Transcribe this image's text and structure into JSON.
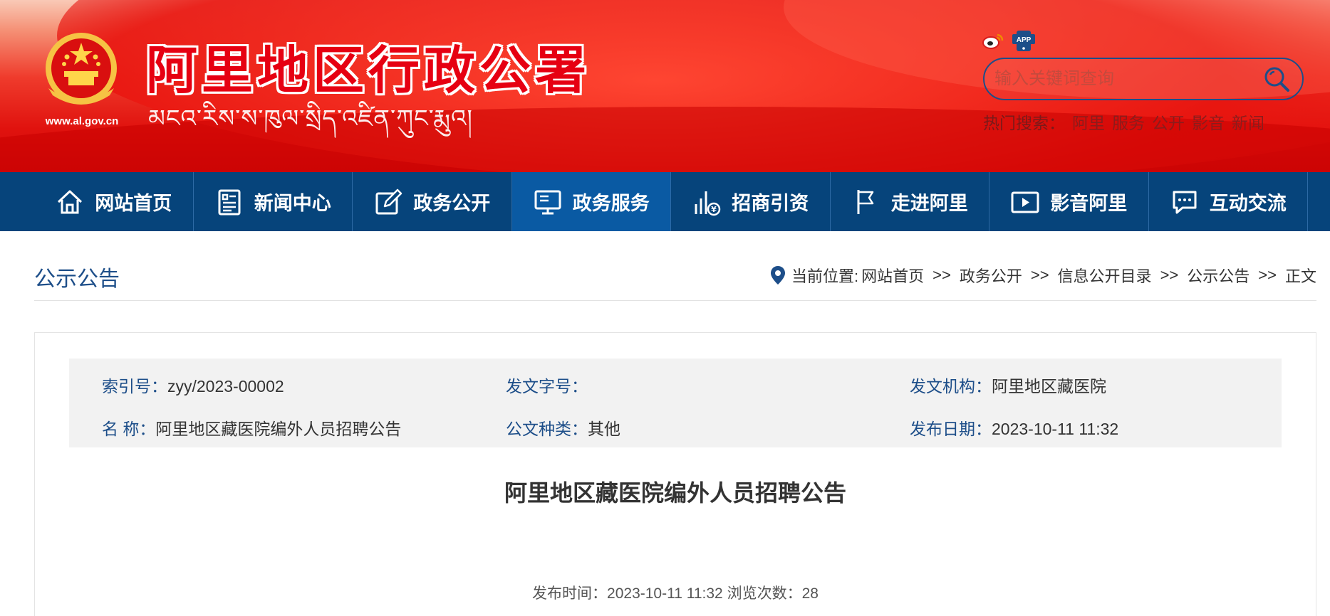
{
  "header": {
    "emblem_url": "www.al.gov.cn",
    "title": "阿里地区行政公署",
    "subtitle": "མངའ་རིས་ས་ཁུལ་སྲིད་འཛིན་ཀུང་རྨུའ།",
    "icons": [
      "weibo-icon",
      "app-icon"
    ],
    "app_label": "APP",
    "search": {
      "placeholder": "输入关键词查询"
    },
    "hot_search": {
      "label": "热门搜索：",
      "items": [
        "阿里",
        "服务",
        "公开",
        "影音",
        "新闻"
      ]
    },
    "colors": {
      "banner_red": "#e60012",
      "nav_blue": "#06447b",
      "accent_blue": "#1d4e89"
    }
  },
  "nav": {
    "items": [
      {
        "label": "网站首页",
        "icon": "home-icon"
      },
      {
        "label": "新闻中心",
        "icon": "news-icon"
      },
      {
        "label": "政务公开",
        "icon": "edit-icon"
      },
      {
        "label": "政务服务",
        "icon": "monitor-icon"
      },
      {
        "label": "招商引资",
        "icon": "investment-icon"
      },
      {
        "label": "走进阿里",
        "icon": "flag-icon"
      },
      {
        "label": "影音阿里",
        "icon": "video-icon"
      },
      {
        "label": "互动交流",
        "icon": "chat-icon"
      }
    ],
    "active_index": 3
  },
  "page": {
    "section_title": "公示公告",
    "breadcrumb": {
      "prefix": "当前位置:",
      "items": [
        "网站首页",
        "政务公开",
        "信息公开目录",
        "公示公告",
        "正文"
      ],
      "separator": ">>"
    }
  },
  "meta": {
    "index_label": "索引号：",
    "index_value": "zyy/2023-00002",
    "doc_no_label": "发文字号：",
    "doc_no_value": "",
    "agency_label": "发文机构：",
    "agency_value": "阿里地区藏医院",
    "name_label": "名 称：",
    "name_value": "阿里地区藏医院编外人员招聘公告",
    "category_label": "公文种类：",
    "category_value": "其他",
    "date_label": "发布日期：",
    "date_value": "2023-10-11 11:32"
  },
  "article": {
    "title": "阿里地区藏医院编外人员招聘公告",
    "publish_label": "发布时间：",
    "publish_time": "2023-10-11 11:32",
    "views_label": "浏览次数：",
    "views": "28"
  }
}
